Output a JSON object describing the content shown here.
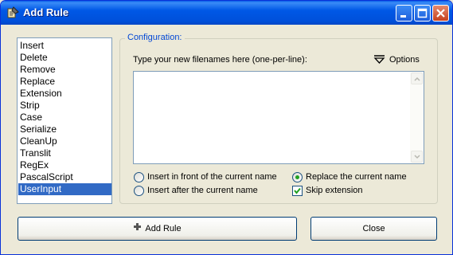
{
  "window": {
    "title": "Add Rule"
  },
  "rules": {
    "items": [
      "Insert",
      "Delete",
      "Remove",
      "Replace",
      "Extension",
      "Strip",
      "Case",
      "Serialize",
      "CleanUp",
      "Translit",
      "RegEx",
      "PascalScript",
      "UserInput"
    ],
    "selected": "UserInput"
  },
  "config": {
    "legend": "Configuration:",
    "hint": "Type your new filenames here (one-per-line):",
    "options_label": "Options",
    "filenames_value": "",
    "radio_insert_front": "Insert in front of the current name",
    "radio_insert_after": "Insert after the current name",
    "radio_replace": "Replace the current name",
    "selected_mode": "Replace the current name",
    "skip_extension_label": "Skip extension",
    "skip_extension_checked": true
  },
  "buttons": {
    "add_rule": "Add Rule",
    "close": "Close"
  },
  "colors": {
    "titlebar": "#0058E6",
    "selection": "#316AC5",
    "legend_text": "#0046D5",
    "radio_dot": "#21A121"
  }
}
